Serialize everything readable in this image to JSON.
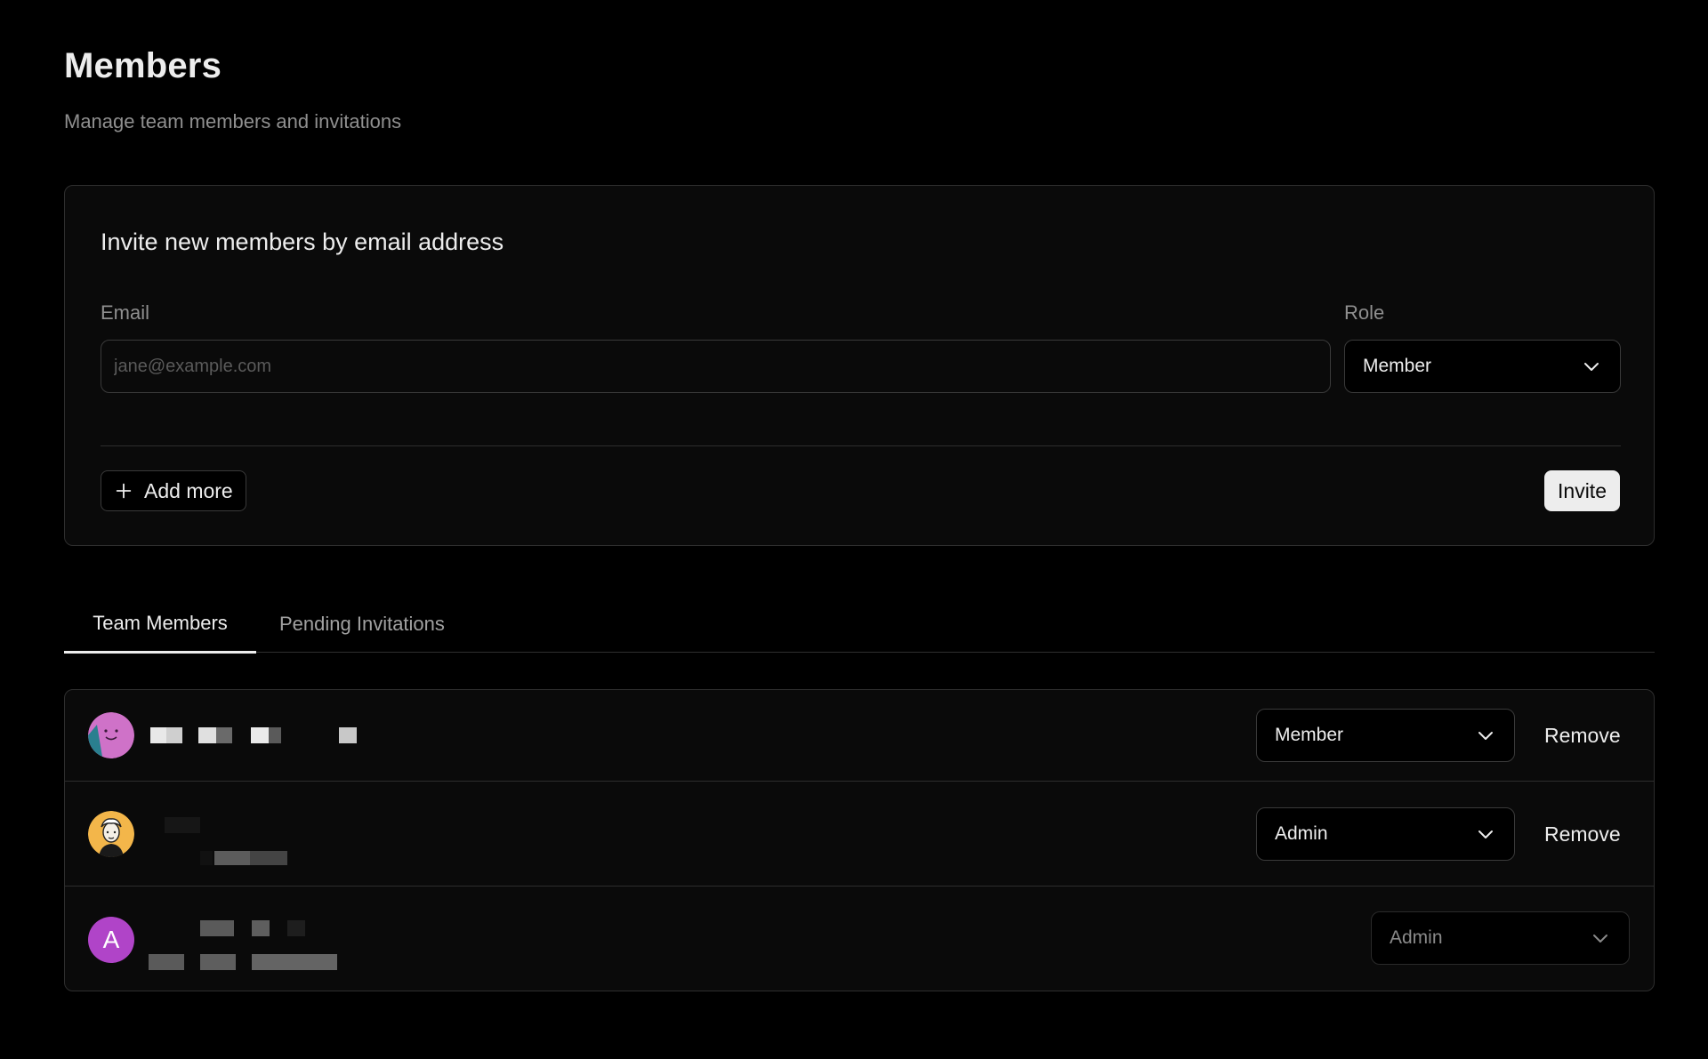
{
  "header": {
    "title": "Members",
    "subtitle": "Manage team members and invitations"
  },
  "invite": {
    "heading": "Invite new members by email address",
    "email_label": "Email",
    "email_placeholder": "jane@example.com",
    "email_value": "",
    "role_label": "Role",
    "role_value": "Member",
    "add_more_label": "Add more",
    "invite_label": "Invite"
  },
  "tabs": [
    {
      "label": "Team Members",
      "active": true
    },
    {
      "label": "Pending Invitations",
      "active": false
    }
  ],
  "members": [
    {
      "name": "",
      "email": "",
      "role": "Member",
      "remove_label": "Remove",
      "role_editable": true
    },
    {
      "name": "",
      "email": "",
      "role": "Admin",
      "remove_label": "Remove",
      "role_editable": true
    },
    {
      "avatar_letter": "A",
      "name": "",
      "email": "",
      "role": "Admin",
      "role_editable": false
    }
  ],
  "icons": {
    "chevron": "chevron-down-icon",
    "plus": "plus-icon"
  },
  "colors": {
    "background": "#000000",
    "surface": "#0a0a0a",
    "border": "#2e2e2e",
    "text_primary": "#ededed",
    "text_muted": "#8f8f8f",
    "avatar_letter_bg": "#b044c8",
    "invite_button_bg": "#ededed"
  }
}
